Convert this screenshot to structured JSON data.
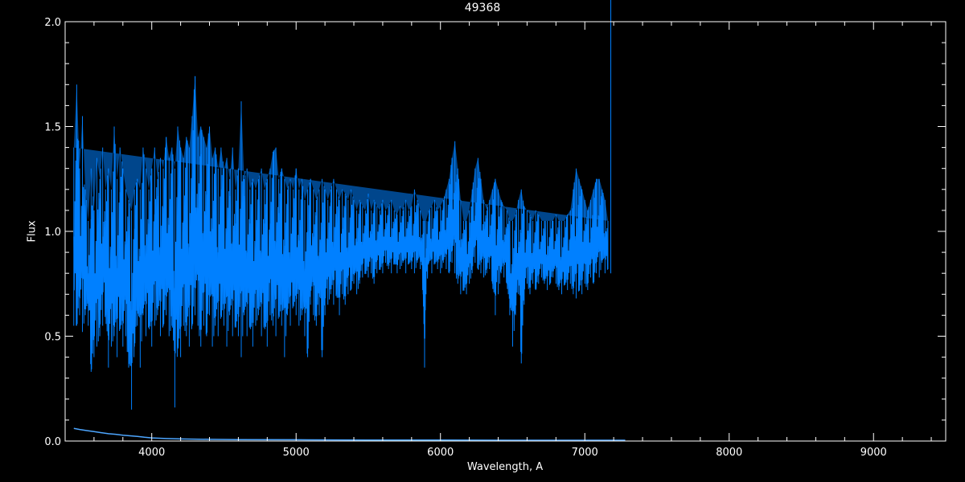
{
  "chart_data": {
    "type": "line",
    "title": "49368",
    "xlabel": "Wavelength, A",
    "ylabel": "Flux",
    "xlim": [
      3400,
      9500
    ],
    "ylim": [
      0.0,
      2.0
    ],
    "xticks": [
      4000,
      5000,
      6000,
      7000,
      8000,
      9000
    ],
    "yticks": [
      0.0,
      0.5,
      1.0,
      1.5,
      2.0
    ],
    "ytick_labels": [
      "0.0",
      "0.5",
      "1.0",
      "1.5",
      "2.0"
    ],
    "grid": false,
    "background": "#000000",
    "axis_color": "#ffffff",
    "series": [
      {
        "role": "flux",
        "color": "#0080ff",
        "x": [
          3460,
          3480,
          3500,
          3520,
          3540,
          3560,
          3580,
          3600,
          3620,
          3640,
          3660,
          3680,
          3700,
          3720,
          3740,
          3760,
          3780,
          3800,
          3820,
          3840,
          3860,
          3880,
          3900,
          3920,
          3940,
          3960,
          3980,
          4000,
          4020,
          4040,
          4060,
          4080,
          4100,
          4120,
          4140,
          4160,
          4180,
          4200,
          4220,
          4240,
          4260,
          4280,
          4300,
          4320,
          4340,
          4360,
          4380,
          4400,
          4420,
          4440,
          4460,
          4480,
          4500,
          4520,
          4540,
          4560,
          4580,
          4600,
          4620,
          4640,
          4660,
          4680,
          4700,
          4720,
          4740,
          4760,
          4780,
          4800,
          4820,
          4840,
          4860,
          4880,
          4900,
          4920,
          4940,
          4960,
          4980,
          5000,
          5020,
          5040,
          5060,
          5080,
          5100,
          5120,
          5140,
          5160,
          5180,
          5200,
          5220,
          5240,
          5260,
          5280,
          5300,
          5320,
          5340,
          5360,
          5380,
          5400,
          5420,
          5440,
          5460,
          5480,
          5500,
          5520,
          5540,
          5560,
          5580,
          5600,
          5620,
          5640,
          5660,
          5680,
          5700,
          5720,
          5740,
          5760,
          5780,
          5800,
          5820,
          5840,
          5860,
          5880,
          5890,
          5900,
          5920,
          5940,
          5960,
          5980,
          6000,
          6020,
          6040,
          6060,
          6080,
          6100,
          6120,
          6140,
          6160,
          6180,
          6200,
          6220,
          6240,
          6260,
          6280,
          6300,
          6320,
          6340,
          6360,
          6380,
          6400,
          6420,
          6440,
          6460,
          6480,
          6500,
          6520,
          6540,
          6560,
          6580,
          6600,
          6620,
          6640,
          6660,
          6680,
          6700,
          6720,
          6740,
          6760,
          6780,
          6800,
          6820,
          6840,
          6860,
          6880,
          6900,
          6920,
          6940,
          6960,
          6980,
          7000,
          7020,
          7040,
          7060,
          7080,
          7100,
          7120,
          7140,
          7160,
          7180,
          7200,
          7220,
          7240,
          7260,
          7280
        ],
        "y_high": [
          1.4,
          1.7,
          1.3,
          1.55,
          1.2,
          1.05,
          1.3,
          1.1,
          1.35,
          1.25,
          1.4,
          1.2,
          1.3,
          1.2,
          1.5,
          1.25,
          1.4,
          1.3,
          1.2,
          1.15,
          1.1,
          1.2,
          1.25,
          1.2,
          1.4,
          1.3,
          1.2,
          1.3,
          1.4,
          1.25,
          1.35,
          1.3,
          1.45,
          1.35,
          1.4,
          1.3,
          1.5,
          1.4,
          1.35,
          1.45,
          1.4,
          1.55,
          1.74,
          1.45,
          1.5,
          1.45,
          1.4,
          1.5,
          1.35,
          1.4,
          1.3,
          1.4,
          1.3,
          1.35,
          1.25,
          1.4,
          1.2,
          1.3,
          1.62,
          1.25,
          1.3,
          1.2,
          1.25,
          1.2,
          1.25,
          1.3,
          1.2,
          1.25,
          1.3,
          1.38,
          1.4,
          1.25,
          1.3,
          1.25,
          1.2,
          1.25,
          1.2,
          1.3,
          1.2,
          1.25,
          1.15,
          1.2,
          1.25,
          1.2,
          1.15,
          1.2,
          1.25,
          1.2,
          1.15,
          1.2,
          1.25,
          1.2,
          1.15,
          1.2,
          1.18,
          1.15,
          1.2,
          1.15,
          1.1,
          1.15,
          1.12,
          1.1,
          1.18,
          1.1,
          1.15,
          1.12,
          1.1,
          1.15,
          1.1,
          1.12,
          1.15,
          1.1,
          1.08,
          1.12,
          1.1,
          1.15,
          1.1,
          1.12,
          1.2,
          1.15,
          1.1,
          1.05,
          1.05,
          1.05,
          1.1,
          1.12,
          1.15,
          1.1,
          1.12,
          1.15,
          1.2,
          1.25,
          1.35,
          1.43,
          1.3,
          1.15,
          1.05,
          1.05,
          1.1,
          1.2,
          1.3,
          1.35,
          1.25,
          1.15,
          1.1,
          1.15,
          1.2,
          1.25,
          1.2,
          1.15,
          1.12,
          1.1,
          1.05,
          1.05,
          1.08,
          1.15,
          1.2,
          1.12,
          1.1,
          1.08,
          1.05,
          1.1,
          1.08,
          1.05,
          1.05,
          1.05,
          1.05,
          1.05,
          1.08,
          1.05,
          1.05,
          1.05,
          1.08,
          1.1,
          1.2,
          1.3,
          1.25,
          1.2,
          1.15,
          1.1,
          1.15,
          1.2,
          1.25,
          1.25,
          1.2,
          1.15,
          1.05
        ],
        "y_low": [
          0.55,
          0.55,
          0.6,
          0.52,
          0.6,
          0.55,
          0.33,
          0.4,
          0.45,
          0.5,
          0.55,
          0.6,
          0.35,
          0.45,
          0.5,
          0.4,
          0.55,
          0.45,
          0.5,
          0.35,
          0.15,
          0.45,
          0.55,
          0.35,
          0.6,
          0.5,
          0.55,
          0.45,
          0.55,
          0.6,
          0.5,
          0.55,
          0.6,
          0.5,
          0.55,
          0.16,
          0.45,
          0.4,
          0.55,
          0.5,
          0.45,
          0.55,
          0.6,
          0.55,
          0.45,
          0.55,
          0.5,
          0.6,
          0.45,
          0.55,
          0.5,
          0.6,
          0.55,
          0.45,
          0.6,
          0.5,
          0.55,
          0.5,
          0.4,
          0.6,
          0.5,
          0.55,
          0.45,
          0.55,
          0.6,
          0.5,
          0.55,
          0.45,
          0.6,
          0.55,
          0.5,
          0.6,
          0.55,
          0.4,
          0.6,
          0.55,
          0.65,
          0.6,
          0.55,
          0.6,
          0.5,
          0.4,
          0.65,
          0.6,
          0.55,
          0.6,
          0.4,
          0.6,
          0.65,
          0.7,
          0.65,
          0.7,
          0.6,
          0.7,
          0.65,
          0.7,
          0.72,
          0.75,
          0.7,
          0.75,
          0.78,
          0.8,
          0.78,
          0.8,
          0.75,
          0.8,
          0.82,
          0.8,
          0.85,
          0.82,
          0.8,
          0.85,
          0.8,
          0.82,
          0.85,
          0.8,
          0.85,
          0.82,
          0.8,
          0.85,
          0.82,
          0.7,
          0.35,
          0.7,
          0.85,
          0.8,
          0.85,
          0.82,
          0.8,
          0.85,
          0.82,
          0.8,
          0.85,
          0.8,
          0.75,
          0.7,
          0.72,
          0.7,
          0.75,
          0.8,
          0.85,
          0.82,
          0.8,
          0.78,
          0.8,
          0.82,
          0.75,
          0.6,
          0.7,
          0.8,
          0.78,
          0.75,
          0.6,
          0.45,
          0.6,
          0.7,
          0.37,
          0.65,
          0.75,
          0.7,
          0.75,
          0.72,
          0.75,
          0.78,
          0.75,
          0.72,
          0.75,
          0.78,
          0.75,
          0.72,
          0.7,
          0.75,
          0.72,
          0.75,
          0.7,
          0.68,
          0.72,
          0.7,
          0.75,
          0.72,
          0.78,
          0.75,
          0.8,
          0.78,
          0.85,
          0.8,
          0.82,
          0.8
        ]
      },
      {
        "role": "error",
        "color": "#4da6ff",
        "x": [
          3460,
          3500,
          3550,
          3600,
          3650,
          3700,
          3750,
          3800,
          3850,
          3900,
          3950,
          4000,
          4100,
          4200,
          4400,
          4600,
          5000,
          5500,
          6000,
          6500,
          7000,
          7280
        ],
        "y": [
          0.06,
          0.055,
          0.05,
          0.045,
          0.04,
          0.035,
          0.032,
          0.028,
          0.025,
          0.022,
          0.018,
          0.015,
          0.012,
          0.01,
          0.008,
          0.007,
          0.006,
          0.005,
          0.005,
          0.004,
          0.004,
          0.004
        ]
      }
    ]
  }
}
